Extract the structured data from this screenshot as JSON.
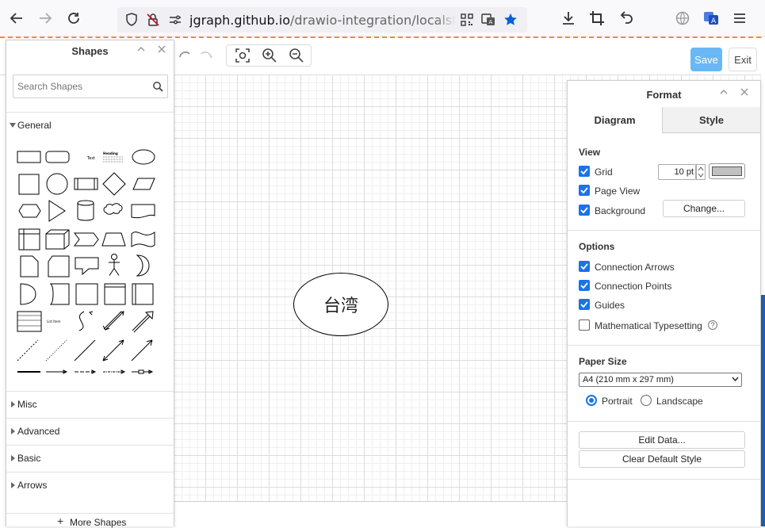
{
  "browser": {
    "url_host": "jgraph.github.io",
    "url_path": "/drawio-integration/localstorage-s"
  },
  "editor": {
    "save_label": "Save",
    "exit_label": "Exit",
    "diagram_shape_text": "台湾"
  },
  "shapes_panel": {
    "title": "Shapes",
    "search_placeholder": "Search Shapes",
    "sections": {
      "general": "General",
      "misc": "Misc",
      "advanced": "Advanced",
      "basic": "Basic",
      "arrows": "Arrows"
    },
    "more_shapes": "More Shapes",
    "sample_text": "Text",
    "sample_heading": "Heading",
    "sample_list_item": "List Item"
  },
  "format_panel": {
    "title": "Format",
    "tabs": {
      "diagram": "Diagram",
      "style": "Style"
    },
    "view": {
      "title": "View",
      "grid": "Grid",
      "grid_size": "10 pt",
      "page_view": "Page View",
      "background": "Background",
      "change_button": "Change...",
      "grid_color": "#c0c0c0"
    },
    "options": {
      "title": "Options",
      "connection_arrows": "Connection Arrows",
      "connection_points": "Connection Points",
      "guides": "Guides",
      "math": "Mathematical Typesetting"
    },
    "paper": {
      "title": "Paper Size",
      "selected": "A4 (210 mm x 297 mm)",
      "portrait": "Portrait",
      "landscape": "Landscape"
    },
    "edit_data_button": "Edit Data...",
    "clear_style_button": "Clear Default Style"
  }
}
